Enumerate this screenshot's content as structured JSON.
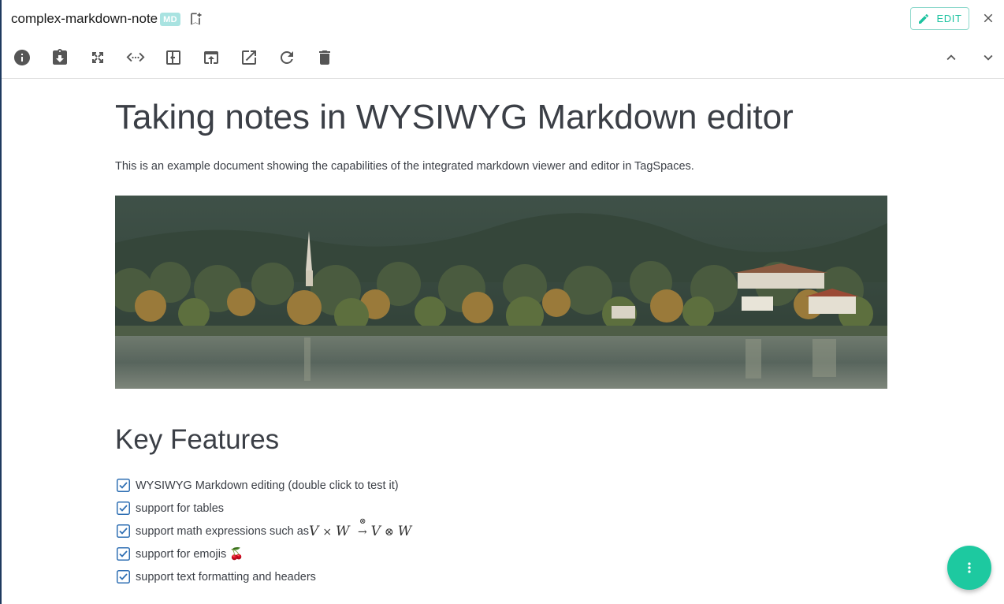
{
  "header": {
    "file_name": "complex-markdown-note",
    "file_ext": "MD",
    "edit_label": "EDIT"
  },
  "toolbar": {
    "tools": [
      "info-icon",
      "download-icon",
      "fullscreen-icon",
      "source-code-icon",
      "move-icon",
      "open-native-icon",
      "open-new-window-icon",
      "reload-icon",
      "delete-icon"
    ]
  },
  "document": {
    "title": "Taking notes in WYSIWYG Markdown editor",
    "intro": "This is an example document showing the capabilities of the integrated markdown viewer and editor in TagSpaces.",
    "section_title": "Key Features",
    "tasks": [
      {
        "label": "WYSIWYG Markdown editing (double click to test it)",
        "checked": true
      },
      {
        "label": "support for tables",
        "checked": true
      },
      {
        "label": "support math expressions such as",
        "checked": true,
        "math": "V × W → V ⊗ W"
      },
      {
        "label": "support for emojis 🍒",
        "checked": true
      },
      {
        "label": "support text formatting and headers",
        "checked": true
      }
    ],
    "math": {
      "v": "V",
      "times": "×",
      "w": "W",
      "arrow_top": "⊗",
      "arrow": "→",
      "v2": "V",
      "otimes": "⊗",
      "w2": "W"
    }
  },
  "colors": {
    "accent": "#1dc3a0",
    "fab": "#1dc9a0",
    "badge": "#a9e3e1",
    "text": "#3b3f46",
    "icon": "#555555"
  }
}
